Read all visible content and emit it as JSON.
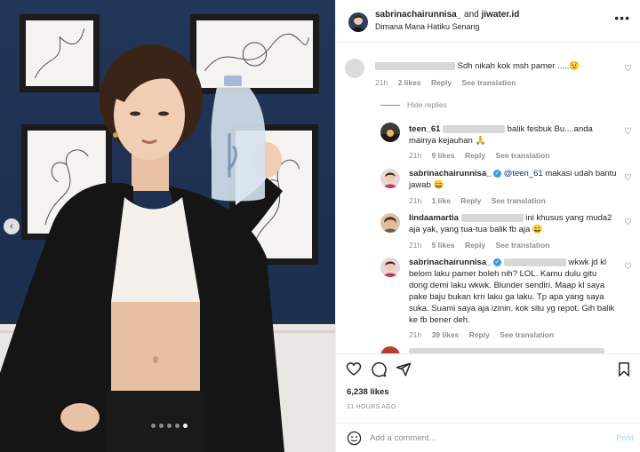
{
  "post": {
    "username": "sabrinachairunnisa_",
    "with_label": "and",
    "collab": "jiwater.id",
    "subtitle": "Dimana Mana Hatiku Senang",
    "more_icon": "more-horizontal-icon"
  },
  "comments": [
    {
      "text": "Sdh nikah kok msh pamer .....😟",
      "time": "21h",
      "likes": "2 likes",
      "reply": "Reply",
      "translate": "See translation"
    }
  ],
  "hide_replies": "Hide replies",
  "replies": [
    {
      "username": "teen_61",
      "text_a": "balik fesbuk Bu....anda",
      "text_b": "mainya kejauhan 🙏",
      "time": "21h",
      "likes": "9 likes",
      "reply": "Reply",
      "translate": "See translation"
    },
    {
      "username": "sabrinachairunnisa_",
      "mention": "@teen_61",
      "text_a": "makasi udah bantu",
      "text_b": "jawab 😄",
      "time": "21h",
      "likes": "1 like",
      "reply": "Reply",
      "translate": "See translation"
    },
    {
      "username": "lindaamartia",
      "text_a": "ini khusus yang muda2",
      "text_b": "aja yak, yang tua-tua balik fb aja 😄",
      "time": "21h",
      "likes": "5 likes",
      "reply": "Reply",
      "translate": "See translation"
    },
    {
      "username": "sabrinachairunnisa_",
      "text_a": "wkwk jd kl",
      "text_lines": [
        "belom laku pamer boleh nih? LOL. Kamu dulu gitu",
        "dong demi laku wkwk. Blunder sendiri. Maap kl saya",
        "pake baju bukan krn laku ga laku. Tp apa yang saya",
        "suka. Suami saya aja izinin. kok situ yg repot. Gih balik",
        "ke fb bener deh."
      ],
      "time": "21h",
      "likes": "39 likes",
      "reply": "Reply",
      "translate": "See translation"
    }
  ],
  "footer": {
    "likes": "6,238 likes",
    "time": "21 HOURS AGO",
    "placeholder": "Add a comment...",
    "post_label": "Post"
  },
  "colors": {
    "link": "#00376b",
    "verified": "#3897f0",
    "muted": "#8e8e8e",
    "post_disabled": "#b2dffc"
  }
}
